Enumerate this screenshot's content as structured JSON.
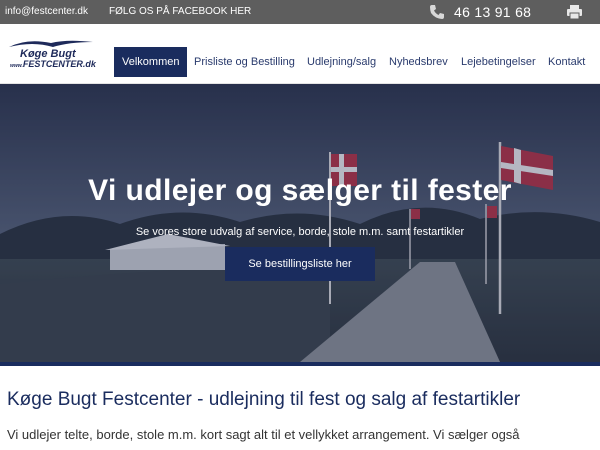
{
  "topbar": {
    "email": "info@festcenter.dk",
    "facebook": "FØLG OS PÅ FACEBOOK HER",
    "phone": "46 13 91 68",
    "phone_icon": "phone-icon",
    "print_icon": "print-icon"
  },
  "logo": {
    "line1": "Køge Bugt",
    "line2_prefix": "www.",
    "line2": "FESTCENTER.dk"
  },
  "nav": {
    "items": [
      {
        "label": "Velkommen",
        "active": true
      },
      {
        "label": "Prisliste og Bestilling"
      },
      {
        "label": "Udlejning/salg"
      },
      {
        "label": "Nyhedsbrev"
      },
      {
        "label": "Lejebetingelser"
      },
      {
        "label": "Kontakt"
      }
    ]
  },
  "hero": {
    "title": "Vi udlejer og sælger til fester",
    "subtitle": "Se vores store udvalg af service, borde, stole m.m. samt festartikler",
    "cta": "Se bestillingsliste her"
  },
  "content": {
    "title": "Køge Bugt Festcenter - udlejning til fest og salg af festartikler",
    "text": "Vi udlejer telte, borde, stole m.m. kort sagt alt til et vellykket arrangement. Vi sælger også"
  },
  "colors": {
    "topbar": "#5e5e5e",
    "brand": "#1a2c5e",
    "hero_overlay": "#34405c"
  }
}
